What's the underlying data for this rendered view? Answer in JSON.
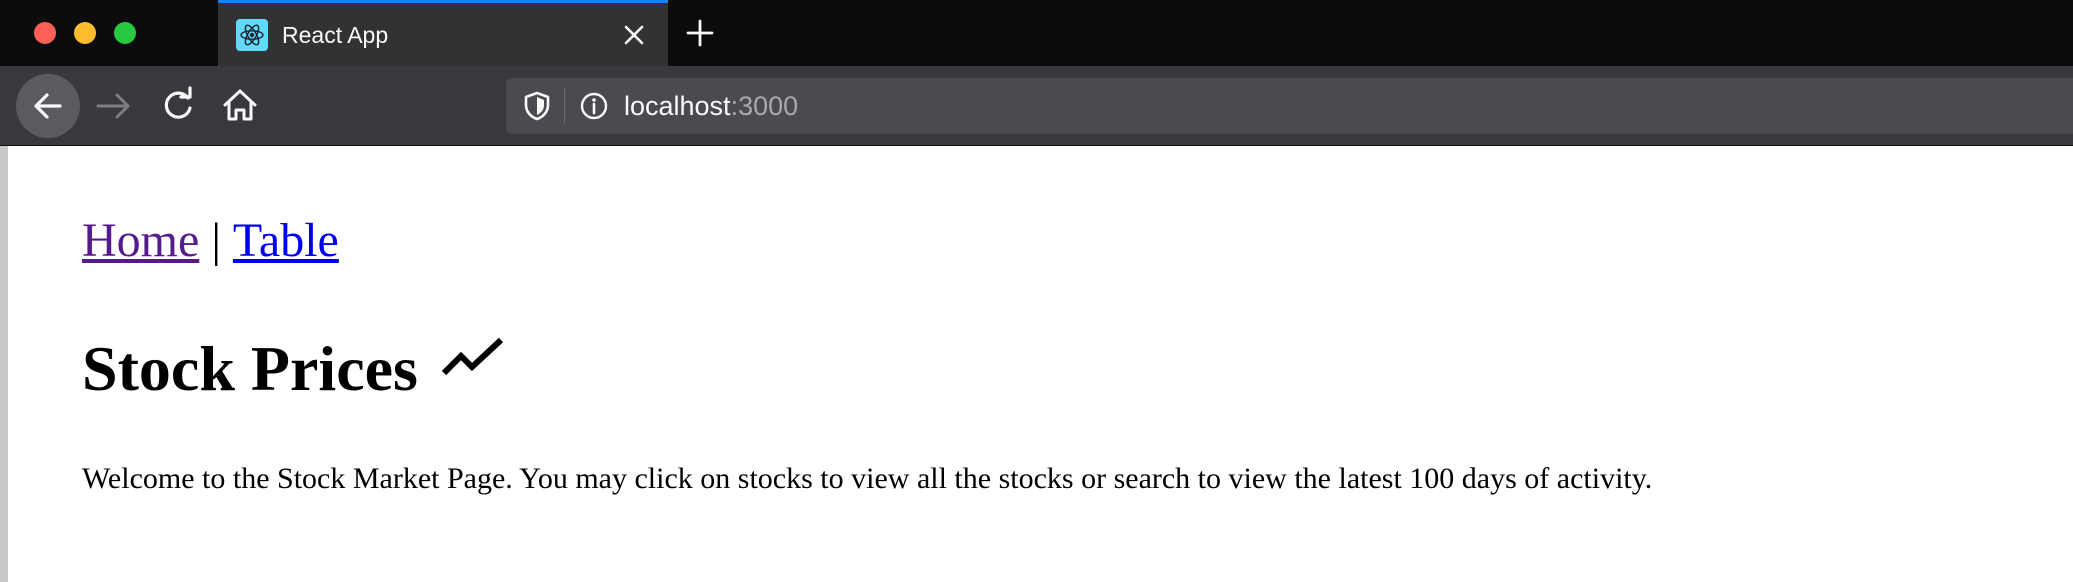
{
  "browser": {
    "tab": {
      "title": "React App",
      "favicon": "react-logo-icon"
    },
    "url": {
      "host": "localhost",
      "port": ":3000"
    },
    "icons": {
      "back": "arrow-left-icon",
      "forward": "arrow-right-icon",
      "reload": "reload-icon",
      "home": "home-icon",
      "shield": "shield-icon",
      "info": "info-icon",
      "close": "close-icon",
      "new_tab": "plus-icon"
    },
    "colors": {
      "tab_accent": "#0a84ff",
      "chrome_dark": "#0c0c0d",
      "toolbar": "#38383d"
    }
  },
  "page": {
    "nav": {
      "home": "Home",
      "separator": "|",
      "table": "Table"
    },
    "heading": "Stock Prices",
    "heading_icon": "trending-up-icon",
    "welcome": "Welcome to the Stock Market Page. You may click on stocks to view all the stocks or search to view the latest 100 days of activity.",
    "colors": {
      "visited_link": "#551a8b",
      "link": "#0000ee"
    }
  }
}
